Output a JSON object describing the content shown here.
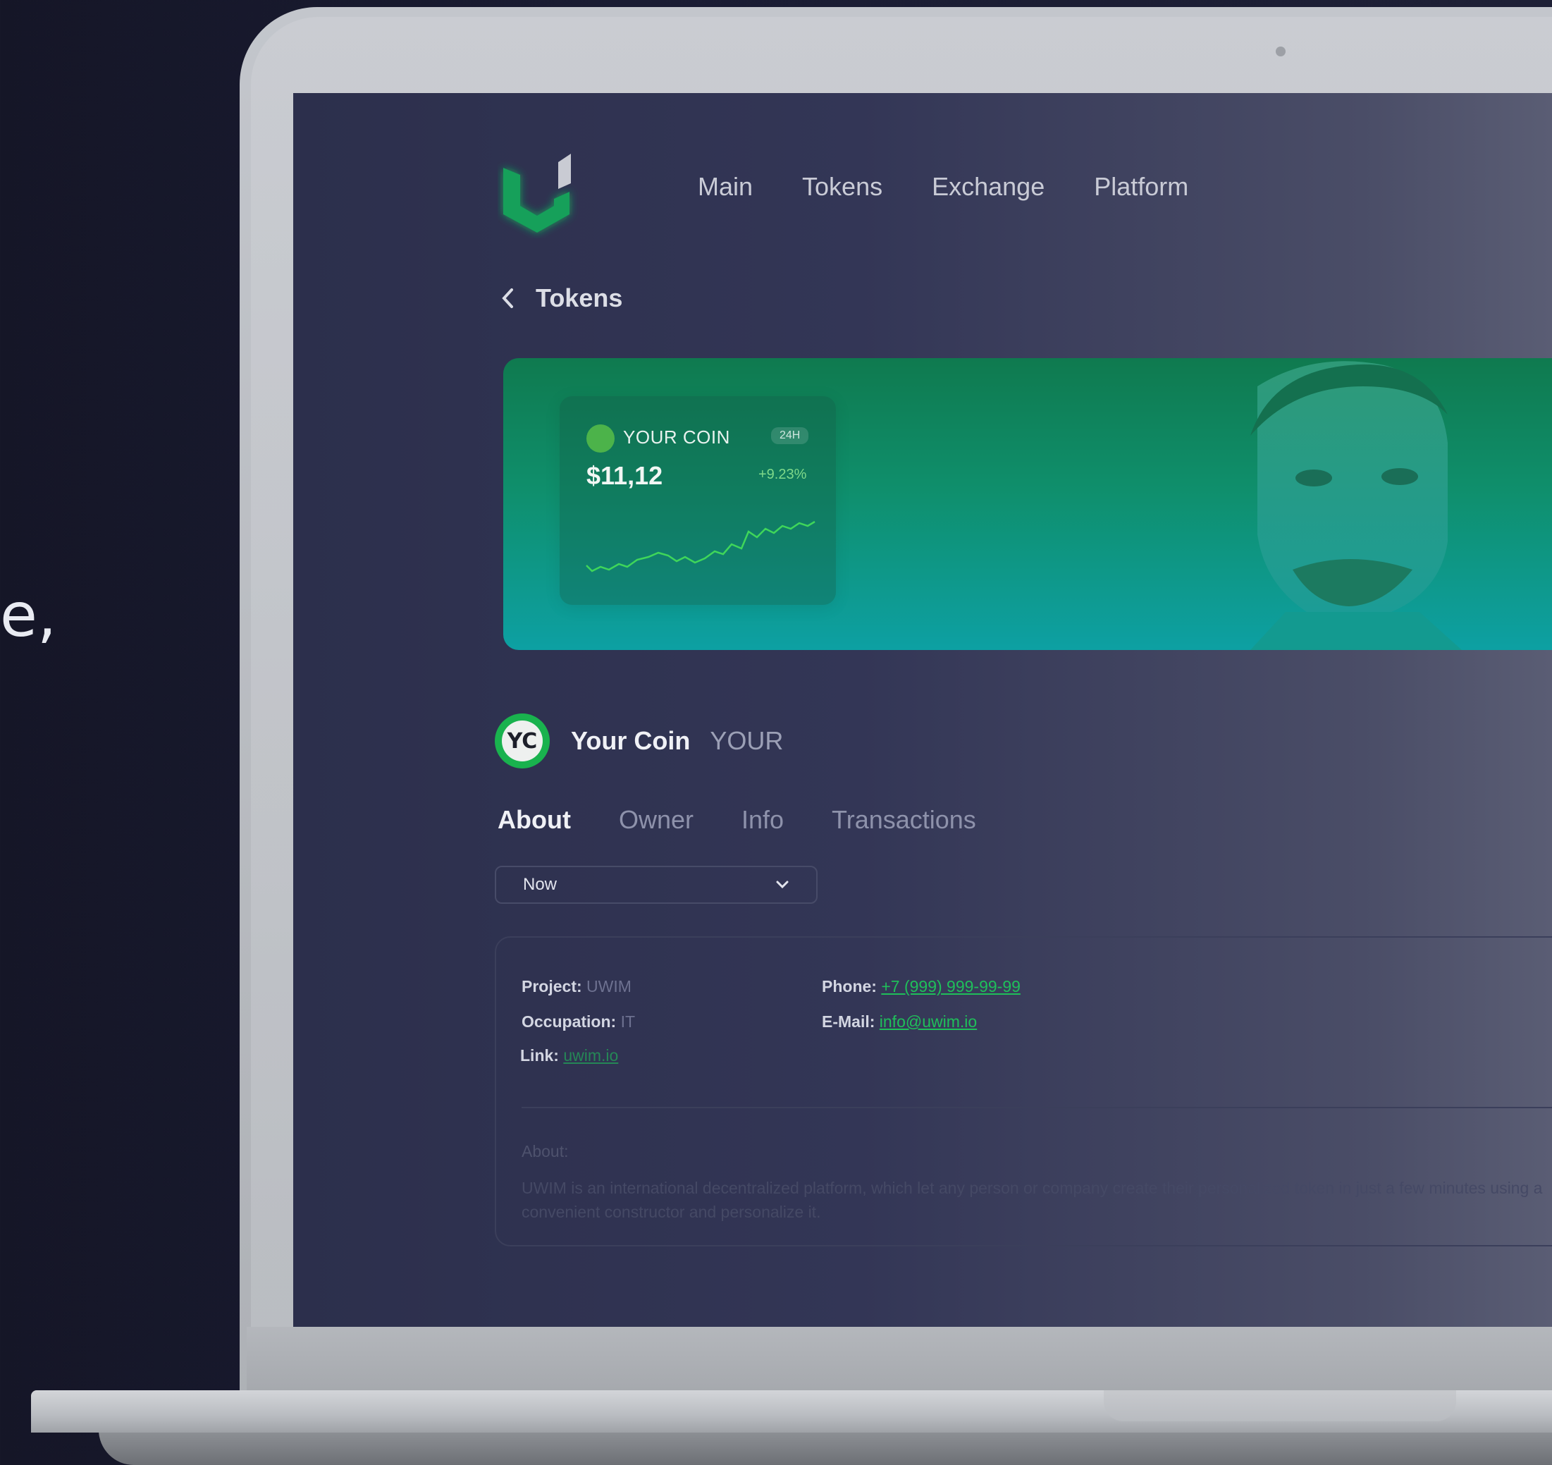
{
  "background": {
    "glyph": "e,"
  },
  "nav": {
    "items": [
      {
        "label": "Main"
      },
      {
        "label": "Tokens"
      },
      {
        "label": "Exchange"
      },
      {
        "label": "Platform"
      }
    ]
  },
  "breadcrumb": {
    "back_label": "Tokens"
  },
  "banner": {
    "coin_name": "YOUR COIN",
    "period": "24H",
    "price": "$11,12",
    "change": "+9.23%",
    "accent": "#4cb34a"
  },
  "coin": {
    "avatar_initials": "YC",
    "title": "Your Coin",
    "ticker": "YOUR"
  },
  "tabs": [
    {
      "label": "About",
      "active": true
    },
    {
      "label": "Owner"
    },
    {
      "label": "Info"
    },
    {
      "label": "Transactions"
    }
  ],
  "period_select": {
    "value": "Now"
  },
  "details": {
    "project_label": "Project:",
    "project_value": "UWIM",
    "occupation_label": "Occupation:",
    "occupation_value": "IT",
    "link_label": "Link:",
    "link_value": "uwim.io",
    "phone_label": "Phone:",
    "phone_value": "+7 (999) 999-99-99",
    "email_label": "E-Mail:",
    "email_value": "info@uwim.io",
    "about_label": "About:",
    "about_text": "UWIM is an international decentralized platform, which let any person or company create their personalized token in just a few minutes using a convenient constructor and personalize it."
  }
}
